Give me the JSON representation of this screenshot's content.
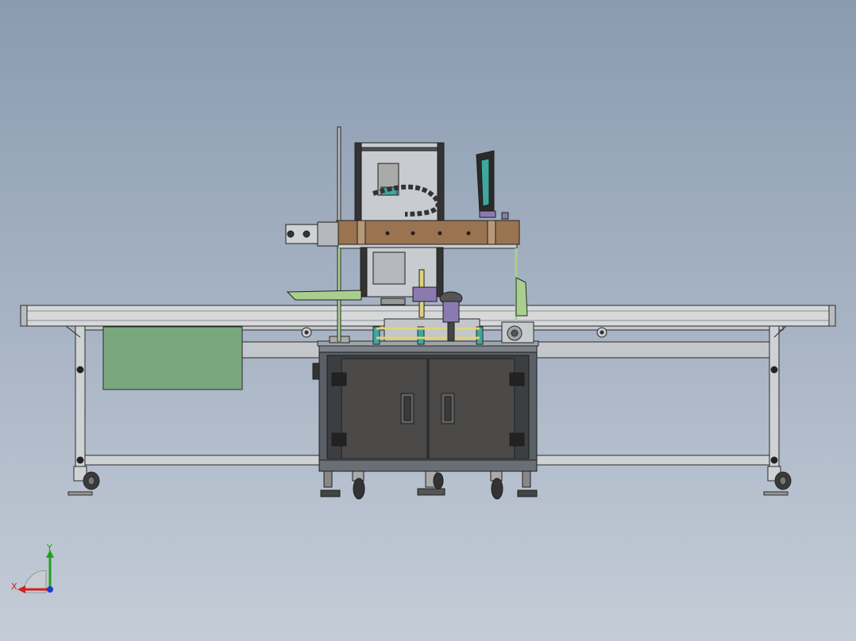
{
  "viewport": {
    "background_top": "#8a9bb0",
    "background_bottom": "#c4ccd7"
  },
  "model": {
    "colors": {
      "frame": "#d6d8da",
      "frame_edge": "#2a2a2a",
      "cabinet": "#555a5f",
      "cabinet_door": "#4b4a48",
      "green_panel": "#7aa87e",
      "wood_plate": "#9a7350",
      "teal": "#3fa7a0",
      "purple": "#8a7ab0",
      "yellow": "#e0d27a",
      "light_green": "#a9cf8f"
    }
  },
  "triad": {
    "x_label": "X",
    "y_label": "Y",
    "x_color": "#d11f1f",
    "y_color": "#1fa11f",
    "z_color": "#1f3bd1"
  }
}
